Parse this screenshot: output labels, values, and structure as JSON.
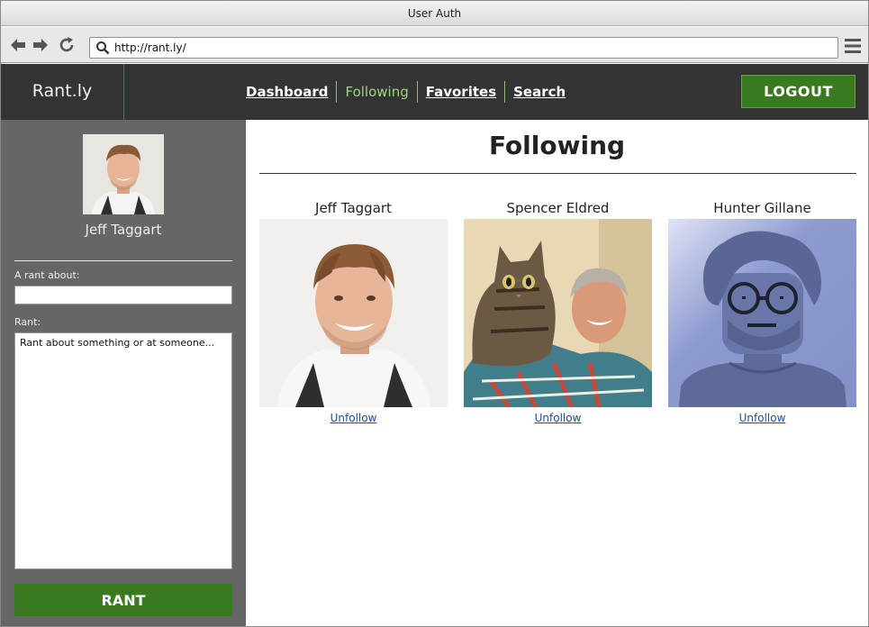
{
  "window": {
    "title": "User Auth"
  },
  "browser": {
    "url": "http://rant.ly/"
  },
  "header": {
    "brand": "Rant.ly",
    "nav": [
      {
        "label": "Dashboard",
        "active": false
      },
      {
        "label": "Following",
        "active": true
      },
      {
        "label": "Favorites",
        "active": false
      },
      {
        "label": "Search",
        "active": false
      }
    ],
    "logout_label": "LOGOUT"
  },
  "sidebar": {
    "user_name": "Jeff Taggart",
    "about_label": "A rant about:",
    "about_value": "",
    "rant_label": "Rant:",
    "rant_placeholder": "Rant about something or at someone...",
    "rant_button": "RANT"
  },
  "main": {
    "title": "Following",
    "following": [
      {
        "name": "Jeff Taggart",
        "action": "Unfollow"
      },
      {
        "name": "Spencer Eldred",
        "action": "Unfollow"
      },
      {
        "name": "Hunter Gillane",
        "action": "Unfollow"
      }
    ]
  },
  "colors": {
    "header_bg": "#333333",
    "sidebar_bg": "#666666",
    "accent_green": "#3a7a1e",
    "active_nav": "#9ed57f",
    "link": "#1a4f9a"
  },
  "icons": [
    "back-arrow-icon",
    "forward-arrow-icon",
    "reload-icon",
    "search-icon",
    "hamburger-menu-icon"
  ]
}
